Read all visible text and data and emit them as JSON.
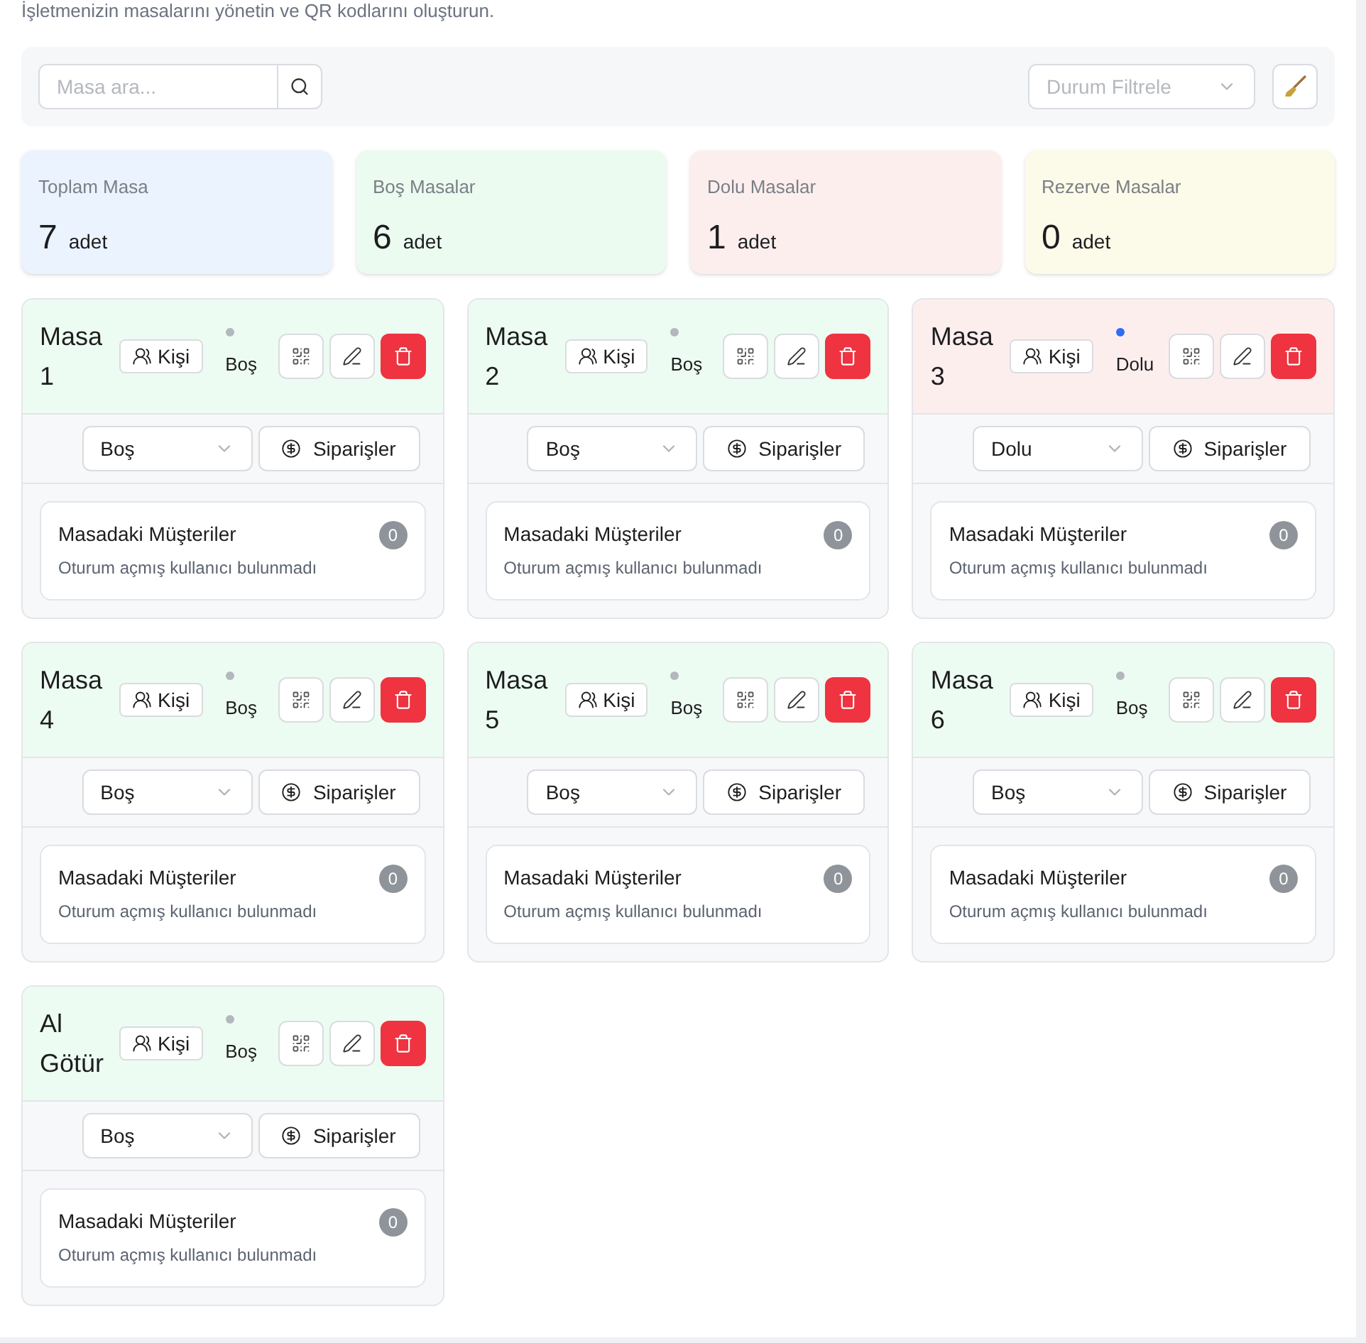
{
  "subtitle": "İşletmenizin masalarını yönetin ve QR kodlarını oluşturun.",
  "search": {
    "placeholder": "Masa ara..."
  },
  "filter": {
    "placeholder": "Durum Filtrele"
  },
  "stats": [
    {
      "kind": "total",
      "label": "Toplam Masa",
      "value": "7",
      "unit": "adet"
    },
    {
      "kind": "empty",
      "label": "Boş Masalar",
      "value": "6",
      "unit": "adet"
    },
    {
      "kind": "full",
      "label": "Dolu Masalar",
      "value": "1",
      "unit": "adet"
    },
    {
      "kind": "reserved",
      "label": "Rezerve Masalar",
      "value": "0",
      "unit": "adet"
    }
  ],
  "tables": [
    {
      "name": "Masa 1",
      "guests_label": "Kişi",
      "kind": "empty",
      "color": "#b3b8bc",
      "status_label": "Boş",
      "select_value": "Boş",
      "orders_label": "Siparişler",
      "customers_title": "Masadaki Müşteriler",
      "customers_count": "0",
      "customers_empty": "Oturum açmış kullanıcı bulunmadı"
    },
    {
      "name": "Masa 2",
      "guests_label": "Kişi",
      "kind": "empty",
      "color": "#b3b8bc",
      "status_label": "Boş",
      "select_value": "Boş",
      "orders_label": "Siparişler",
      "customers_title": "Masadaki Müşteriler",
      "customers_count": "0",
      "customers_empty": "Oturum açmış kullanıcı bulunmadı"
    },
    {
      "name": "Masa 3",
      "guests_label": "Kişi",
      "kind": "full",
      "color": "#2f6df6",
      "status_label": "Dolu",
      "select_value": "Dolu",
      "orders_label": "Siparişler",
      "customers_title": "Masadaki Müşteriler",
      "customers_count": "0",
      "customers_empty": "Oturum açmış kullanıcı bulunmadı"
    },
    {
      "name": "Masa 4",
      "guests_label": "Kişi",
      "kind": "empty",
      "color": "#b3b8bc",
      "status_label": "Boş",
      "select_value": "Boş",
      "orders_label": "Siparişler",
      "customers_title": "Masadaki Müşteriler",
      "customers_count": "0",
      "customers_empty": "Oturum açmış kullanıcı bulunmadı"
    },
    {
      "name": "Masa 5",
      "guests_label": "Kişi",
      "kind": "empty",
      "color": "#b3b8bc",
      "status_label": "Boş",
      "select_value": "Boş",
      "orders_label": "Siparişler",
      "customers_title": "Masadaki Müşteriler",
      "customers_count": "0",
      "customers_empty": "Oturum açmış kullanıcı bulunmadı"
    },
    {
      "name": "Masa 6",
      "guests_label": "Kişi",
      "kind": "empty",
      "color": "#b3b8bc",
      "status_label": "Boş",
      "select_value": "Boş",
      "orders_label": "Siparişler",
      "customers_title": "Masadaki Müşteriler",
      "customers_count": "0",
      "customers_empty": "Oturum açmış kullanıcı bulunmadı"
    },
    {
      "name": "Al Götür",
      "guests_label": "Kişi",
      "kind": "empty",
      "color": "#b3b8bc",
      "status_label": "Boş",
      "select_value": "Boş",
      "orders_label": "Siparişler",
      "customers_title": "Masadaki Müşteriler",
      "customers_count": "0",
      "customers_empty": "Oturum açmış kullanıcı bulunmadı"
    }
  ]
}
